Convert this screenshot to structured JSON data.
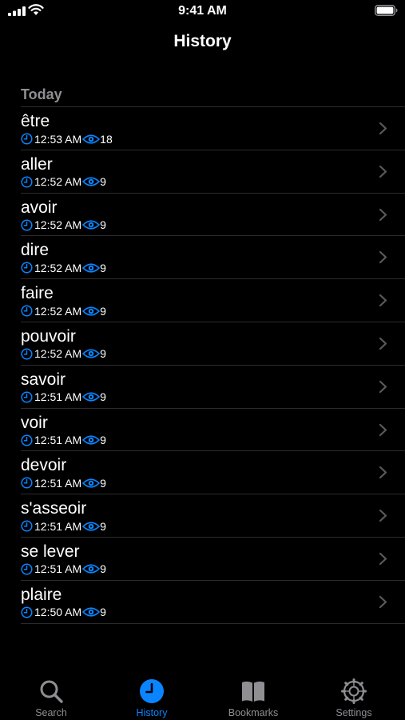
{
  "status_bar": {
    "time": "9:41 AM"
  },
  "header": {
    "title": "History"
  },
  "section": {
    "title": "Today"
  },
  "colors": {
    "accent": "#0a84ff",
    "secondary": "#8e8e93",
    "separator": "#2c2c2e"
  },
  "history": [
    {
      "word": "être",
      "time": "12:53 AM",
      "views": "18"
    },
    {
      "word": "aller",
      "time": "12:52 AM",
      "views": "9"
    },
    {
      "word": "avoir",
      "time": "12:52 AM",
      "views": "9"
    },
    {
      "word": "dire",
      "time": "12:52 AM",
      "views": "9"
    },
    {
      "word": "faire",
      "time": "12:52 AM",
      "views": "9"
    },
    {
      "word": "pouvoir",
      "time": "12:52 AM",
      "views": "9"
    },
    {
      "word": "savoir",
      "time": "12:51 AM",
      "views": "9"
    },
    {
      "word": "voir",
      "time": "12:51 AM",
      "views": "9"
    },
    {
      "word": "devoir",
      "time": "12:51 AM",
      "views": "9"
    },
    {
      "word": "s'asseoir",
      "time": "12:51 AM",
      "views": "9"
    },
    {
      "word": "se lever",
      "time": "12:51 AM",
      "views": "9"
    },
    {
      "word": "plaire",
      "time": "12:50 AM",
      "views": "9"
    }
  ],
  "tab_bar": {
    "tabs": [
      {
        "label": "Search",
        "icon": "search-icon",
        "active": false
      },
      {
        "label": "History",
        "icon": "clock-icon",
        "active": true
      },
      {
        "label": "Bookmarks",
        "icon": "book-icon",
        "active": false
      },
      {
        "label": "Settings",
        "icon": "gear-icon",
        "active": false
      }
    ]
  }
}
